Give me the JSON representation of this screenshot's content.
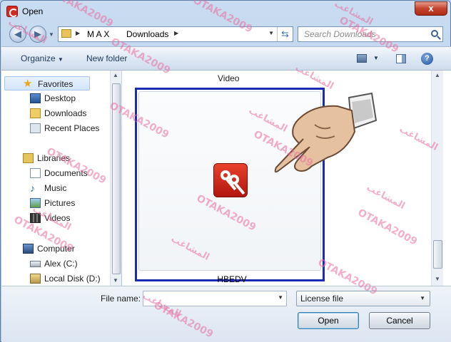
{
  "window": {
    "title": "Open",
    "close_symbol": "x"
  },
  "navigation": {
    "breadcrumbs": [
      "M A X",
      "Downloads"
    ],
    "search_placeholder": "Search Downloads"
  },
  "toolbar": {
    "organize_label": "Organize",
    "new_folder_label": "New folder"
  },
  "sidebar": {
    "items": [
      {
        "label": "Favorites",
        "icon": "star-icon",
        "group": true
      },
      {
        "label": "Desktop",
        "icon": "desktop-icon"
      },
      {
        "label": "Downloads",
        "icon": "downloads-folder-icon"
      },
      {
        "label": "Recent Places",
        "icon": "recent-places-icon"
      },
      {
        "label": "Libraries",
        "icon": "libraries-icon",
        "group": true
      },
      {
        "label": "Documents",
        "icon": "documents-icon"
      },
      {
        "label": "Music",
        "icon": "music-icon"
      },
      {
        "label": "Pictures",
        "icon": "pictures-icon"
      },
      {
        "label": "Videos",
        "icon": "videos-icon"
      },
      {
        "label": "Computer",
        "icon": "computer-icon",
        "group": true
      },
      {
        "label": "Alex (C:)",
        "icon": "drive-icon"
      },
      {
        "label": "Local Disk (D:)",
        "icon": "drive-icon"
      }
    ]
  },
  "content": {
    "folder_label": "Video",
    "selected_file": {
      "name": "HBEDV",
      "icon": "keys-icon"
    }
  },
  "footer": {
    "file_name_label": "File name:",
    "file_name_value": "",
    "file_type_value": "License file",
    "open_label": "Open",
    "cancel_label": "Cancel"
  },
  "watermark": {
    "latin": "OTAKA2009",
    "arabic": "المشاغب"
  },
  "colors": {
    "selection_border": "#1a2db0",
    "app_icon": "#d42a22"
  }
}
